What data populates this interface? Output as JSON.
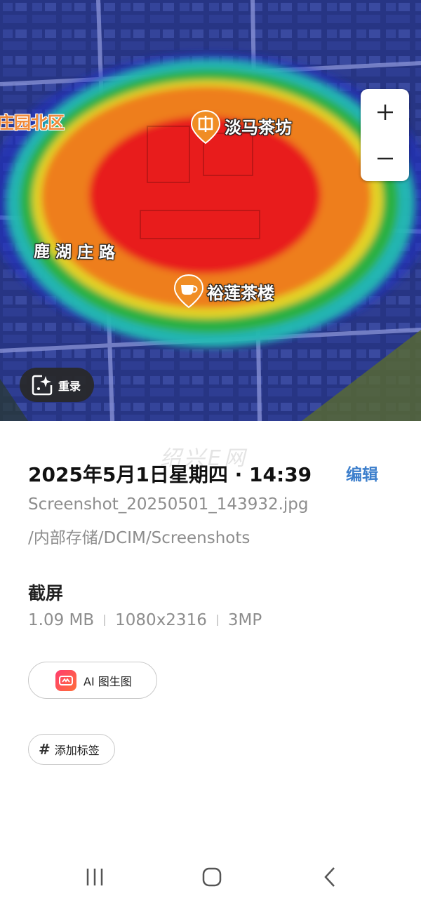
{
  "map": {
    "area_label": "庄园北区",
    "road_label": "鹿湖庄路",
    "pois": [
      {
        "name": "淡马茶坊",
        "icon": "shop-icon"
      },
      {
        "name": "裕莲茶楼",
        "icon": "teacup-icon"
      }
    ],
    "zoom_in": "+",
    "zoom_out": "−",
    "remaster_label": "重录",
    "heatmap_colors": [
      "#1d2fc9",
      "#26c3b2",
      "#2cb043",
      "#e3d227",
      "#ee7e1f",
      "#e81e1e"
    ]
  },
  "details": {
    "watermark": "绍兴E网",
    "datetime": "2025年5月1日星期四 · 14:39",
    "edit_label": "编辑",
    "filename": "Screenshot_20250501_143932.jpg",
    "path": "/内部存储/DCIM/Screenshots",
    "type": "截屏",
    "specs": [
      "1.09 MB",
      "1080x2316",
      "3MP"
    ],
    "ai_button": "AI 图生图",
    "tag_button": "添加标签"
  },
  "accent_color": "#3d7fcc"
}
